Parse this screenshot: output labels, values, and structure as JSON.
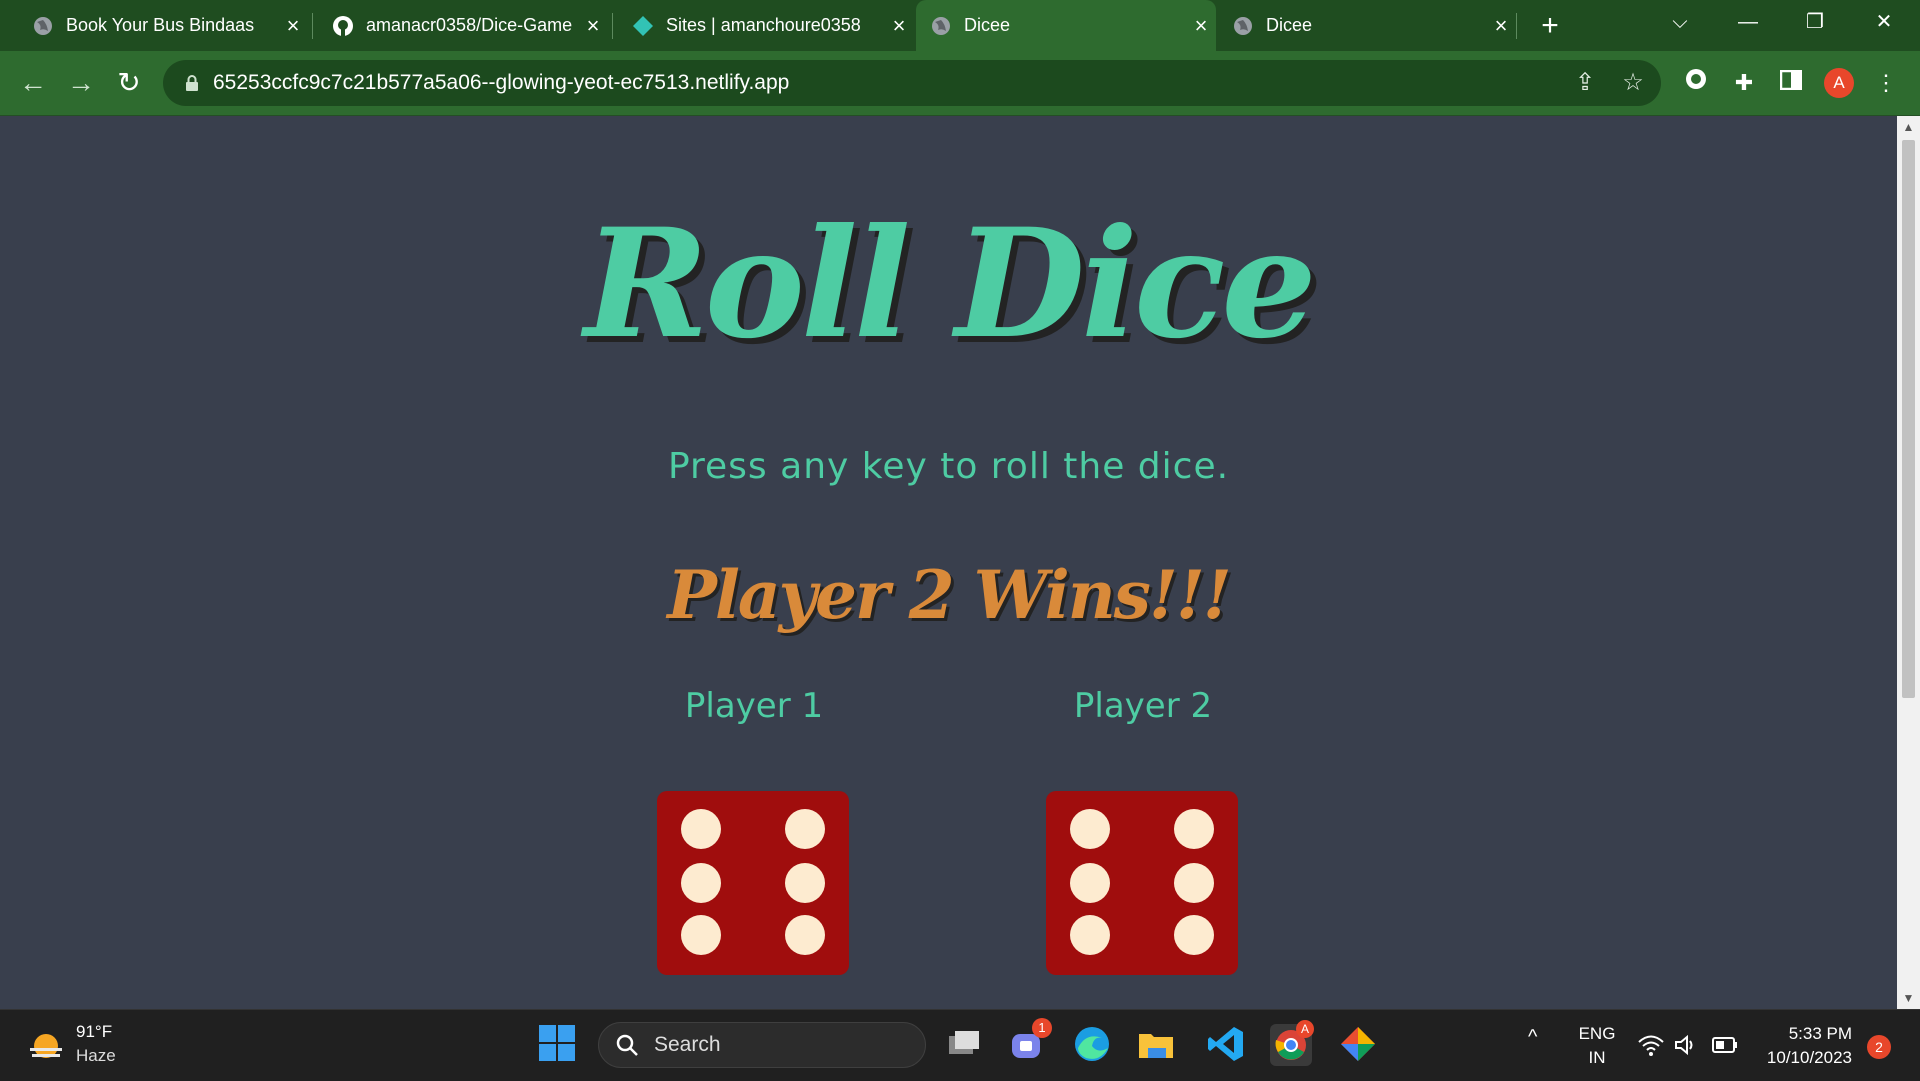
{
  "browser": {
    "tabs": [
      {
        "title": "Book Your Bus Bindaas",
        "icon": "globe-icon",
        "active": false
      },
      {
        "title": "amanacr0358/Dice-Game",
        "icon": "github-icon",
        "active": false
      },
      {
        "title": "Sites | amanchoure0358",
        "icon": "netlify-icon",
        "active": false
      },
      {
        "title": "Dicee",
        "icon": "globe-icon",
        "active": true
      },
      {
        "title": "Dicee",
        "icon": "globe-icon",
        "active": false
      }
    ],
    "url": "65253ccfc9c7c21b577a5a06--glowing-yeot-ec7513.netlify.app",
    "profile_initial": "A",
    "theme_color": "#2e6b2f"
  },
  "page": {
    "title": "Roll Dice",
    "instruction": "Press any key to roll the dice.",
    "result": "Player 2 Wins!!!",
    "players": [
      {
        "label": "Player 1",
        "die_value": 6
      },
      {
        "label": "Player 2",
        "die_value": 6
      }
    ],
    "accent_color": "#4ecca3",
    "result_color": "#d98a3a",
    "die_color": "#a00d0d",
    "background": "#393f4d"
  },
  "taskbar": {
    "weather": {
      "temp": "91°F",
      "desc": "Haze"
    },
    "search_label": "Search",
    "teams_badge": "1",
    "language": {
      "line1": "ENG",
      "line2": "IN"
    },
    "time": "5:33 PM",
    "date": "10/10/2023",
    "notification_count": "2"
  }
}
